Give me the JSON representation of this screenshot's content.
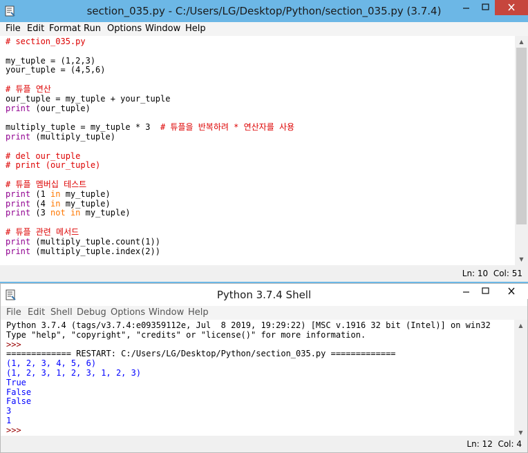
{
  "editor": {
    "title": "section_035.py - C:/Users/LG/Desktop/Python/section_035.py (3.7.4)",
    "menu": [
      "File",
      "Edit",
      "Format",
      "Run",
      "Options",
      "Window",
      "Help"
    ],
    "lines": [
      [
        [
          "comment",
          "# section_035.py"
        ]
      ],
      [],
      [
        [
          "plain",
          "my_tuple = (1,2,3)"
        ]
      ],
      [
        [
          "plain",
          "your_tuple = (4,5,6)"
        ]
      ],
      [],
      [
        [
          "comment",
          "# 튜플 연산"
        ]
      ],
      [
        [
          "plain",
          "our_tuple = my_tuple + your_tuple"
        ]
      ],
      [
        [
          "builtin",
          "print"
        ],
        [
          "plain",
          " (our_tuple)"
        ]
      ],
      [],
      [
        [
          "plain",
          "multiply_tuple = my_tuple * 3  "
        ],
        [
          "comment",
          "# 튜플을 반복하려 * 연산자를 사용"
        ]
      ],
      [
        [
          "builtin",
          "print"
        ],
        [
          "plain",
          " (multiply_tuple)"
        ]
      ],
      [],
      [
        [
          "comment",
          "# del our_tuple"
        ]
      ],
      [
        [
          "comment",
          "# print (our_tuple)"
        ]
      ],
      [],
      [
        [
          "comment",
          "# 튜플 멤버십 테스트"
        ]
      ],
      [
        [
          "builtin",
          "print"
        ],
        [
          "plain",
          " (1 "
        ],
        [
          "keyword",
          "in"
        ],
        [
          "plain",
          " my_tuple)"
        ]
      ],
      [
        [
          "builtin",
          "print"
        ],
        [
          "plain",
          " (4 "
        ],
        [
          "keyword",
          "in"
        ],
        [
          "plain",
          " my_tuple)"
        ]
      ],
      [
        [
          "builtin",
          "print"
        ],
        [
          "plain",
          " (3 "
        ],
        [
          "keyword",
          "not"
        ],
        [
          "plain",
          " "
        ],
        [
          "keyword",
          "in"
        ],
        [
          "plain",
          " my_tuple)"
        ]
      ],
      [],
      [
        [
          "comment",
          "# 튜플 관련 메서드"
        ]
      ],
      [
        [
          "builtin",
          "print"
        ],
        [
          "plain",
          " (multiply_tuple.count(1))"
        ]
      ],
      [
        [
          "builtin",
          "print"
        ],
        [
          "plain",
          " (multiply_tuple.index(2))"
        ]
      ]
    ],
    "status": "Ln: 10  Col: 51",
    "scroll_thumb_fraction": 0.86
  },
  "shell": {
    "title": "Python 3.7.4 Shell",
    "menu": [
      "File",
      "Edit",
      "Shell",
      "Debug",
      "Options",
      "Window",
      "Help"
    ],
    "lines": [
      [
        [
          "plain",
          "Python 3.7.4 (tags/v3.7.4:e09359112e, Jul  8 2019, 19:29:22) [MSC v.1916 32 bit (Intel)] on win32"
        ]
      ],
      [
        [
          "plain",
          "Type \"help\", \"copyright\", \"credits\" or \"license()\" for more information."
        ]
      ],
      [
        [
          "prompt",
          ">>> "
        ]
      ],
      [
        [
          "restart",
          "============= RESTART: C:/Users/LG/Desktop/Python/section_035.py ============="
        ]
      ],
      [
        [
          "out",
          "(1, 2, 3, 4, 5, 6)"
        ]
      ],
      [
        [
          "out",
          "(1, 2, 3, 1, 2, 3, 1, 2, 3)"
        ]
      ],
      [
        [
          "out",
          "True"
        ]
      ],
      [
        [
          "out",
          "False"
        ]
      ],
      [
        [
          "out",
          "False"
        ]
      ],
      [
        [
          "out",
          "3"
        ]
      ],
      [
        [
          "out",
          "1"
        ]
      ],
      [
        [
          "prompt",
          ">>> "
        ]
      ]
    ],
    "status": "Ln: 12  Col: 4"
  },
  "icons": {
    "app": "python-idle-icon",
    "minimize": "minimize-icon",
    "maximize": "maximize-icon",
    "close": "close-icon"
  },
  "colors": {
    "active_titlebar": "#6cb7e6",
    "close_button": "#c6463d",
    "comment": "#dd0000",
    "builtin": "#900090",
    "keyword": "#ff7700",
    "output": "#0000ff"
  }
}
